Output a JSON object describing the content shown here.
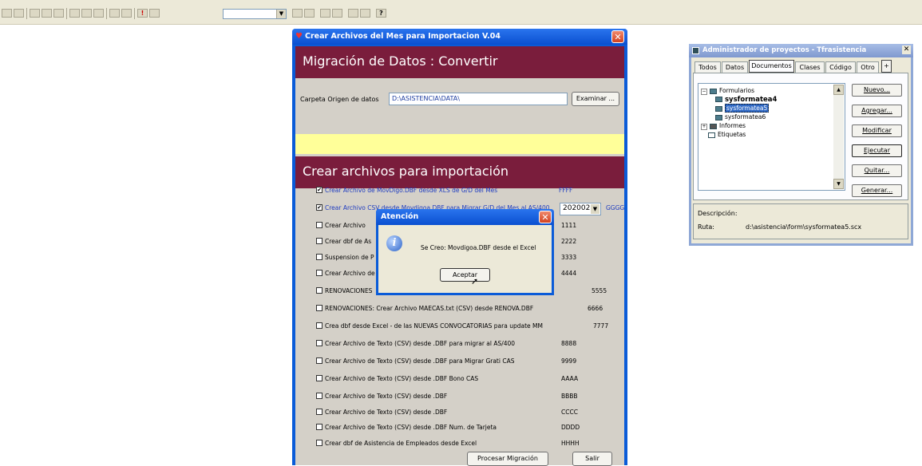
{
  "toolbar": {
    "icons": [
      "new-icon",
      "save-icon",
      "print-icon",
      "preview-icon",
      "spell-icon",
      "cut-icon",
      "copy-icon",
      "paste-icon",
      "undo-icon",
      "redo-icon",
      "run-icon",
      "modify-icon",
      "combo",
      "command-icon",
      "view-icon",
      "data-icon",
      "forms-icon",
      "code-icon",
      "properties-icon",
      "help-icon"
    ],
    "combo_value": ""
  },
  "main_window": {
    "title": "Crear Archivos del Mes para Importacion  V.04",
    "header": "Migración de Datos : Convertir",
    "folder_label": "Carpeta Origen de datos",
    "folder_value": "D:\\ASISTENCIA\\DATA\\",
    "browse_button": "Examinar ...",
    "section_header": "Crear archivos para importación",
    "period_value": "202002",
    "rows": [
      {
        "label": "Crear Archivo de  MovDigo.DBF desde XLS de G/D  del Mes",
        "code": "FFFF",
        "checked": true,
        "highlight": true
      },
      {
        "label": "Crear Archivo CSV desde  Movdigoa.DBF  para Migrar G/D del Mes al AS/400",
        "code": "GGGG",
        "checked": true,
        "highlight": true
      },
      {
        "label": "Crear Archivo",
        "code": "1111",
        "checked": false,
        "highlight": false
      },
      {
        "label": "Crear  dbf de As",
        "code": "2222",
        "checked": false,
        "highlight": false
      },
      {
        "label": "Suspension de P",
        "code": "3333",
        "checked": false,
        "highlight": false
      },
      {
        "label": "Crear Archivo de",
        "code": "4444",
        "checked": false,
        "highlight": false
      },
      {
        "label": "RENOVACIONES",
        "code": "5555",
        "checked": false,
        "highlight": false
      },
      {
        "label": "RENOVACIONES: Crear Archivo MAECAS.txt (CSV) desde  RENOVA.DBF",
        "code": "6666",
        "checked": false,
        "highlight": false
      },
      {
        "label": "Crea dbf desde Excel - de las NUEVAS CONVOCATORIAS para update MM",
        "code": "7777",
        "checked": false,
        "highlight": false
      },
      {
        "label": "Crear Archivo de Texto (CSV) desde  .DBF  para migrar al AS/400",
        "code": "8888",
        "checked": false,
        "highlight": false
      },
      {
        "label": "Crear Archivo de Texto (CSV) desde  .DBF  para Migrar Grati CAS",
        "code": "9999",
        "checked": false,
        "highlight": false
      },
      {
        "label": "Crear Archivo de Texto (CSV) desde  .DBF  Bono CAS",
        "code": "AAAA",
        "checked": false,
        "highlight": false
      },
      {
        "label": "Crear Archivo de Texto (CSV) desde  .DBF",
        "code": "BBBB",
        "checked": false,
        "highlight": false
      },
      {
        "label": "Crear Archivo de Texto (CSV) desde  .DBF",
        "code": "CCCC",
        "checked": false,
        "highlight": false
      },
      {
        "label": "Crear Archivo de Texto (CSV) desde  .DBF  Num. de Tarjeta",
        "code": "DDDD",
        "checked": false,
        "highlight": false
      },
      {
        "label": "Crear  dbf de Asistencia  de Empleados desde  Excel",
        "code": "HHHH",
        "checked": false,
        "highlight": false
      }
    ],
    "process_button": "Procesar Migración",
    "exit_button": "Salir"
  },
  "dialog": {
    "title": "Atención",
    "message": "Se Creo: Movdigoa.DBF desde el Excel",
    "ok_button": "Aceptar"
  },
  "project_manager": {
    "title": "Administrador de proyectos - Tfrasistencia",
    "tabs": [
      "Todos",
      "Datos",
      "Documentos",
      "Clases",
      "Código",
      "Otro"
    ],
    "selected_tab": "Documentos",
    "tree": {
      "forms_label": "Formularios",
      "items": [
        "sysformatea4",
        "sysformatea5",
        "sysformatea6"
      ],
      "reports_label": "Informes",
      "labels_label": "Etiquetas"
    },
    "buttons": [
      "Nuevo...",
      "Agregar...",
      "Modificar",
      "Ejecutar",
      "Quitar...",
      "Generar..."
    ],
    "description_label": "Descripción:",
    "path_label": "Ruta:",
    "path_value": "d:\\asistencia\\form\\sysformatea5.scx"
  }
}
